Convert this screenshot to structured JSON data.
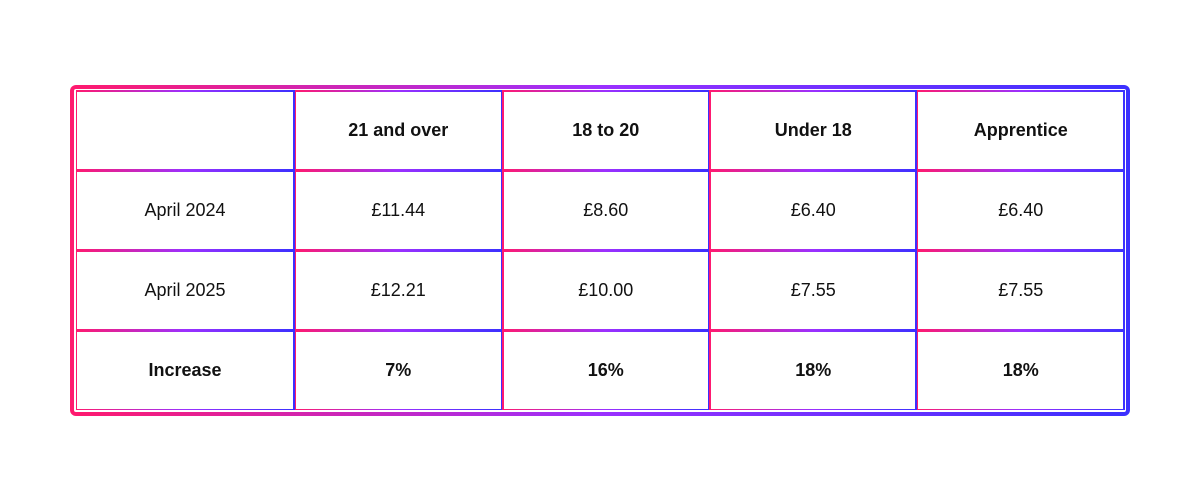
{
  "table": {
    "headers": {
      "col0": "",
      "col1": "21 and over",
      "col2": "18 to 20",
      "col3": "Under 18",
      "col4": "Apprentice"
    },
    "rows": [
      {
        "label": "April 2024",
        "col1": "£11.44",
        "col2": "£8.60",
        "col3": "£6.40",
        "col4": "£6.40"
      },
      {
        "label": "April 2025",
        "col1": "£12.21",
        "col2": "£10.00",
        "col3": "£7.55",
        "col4": "£7.55"
      },
      {
        "label": "Increase",
        "col1": "7%",
        "col2": "16%",
        "col3": "18%",
        "col4": "18%"
      }
    ]
  }
}
